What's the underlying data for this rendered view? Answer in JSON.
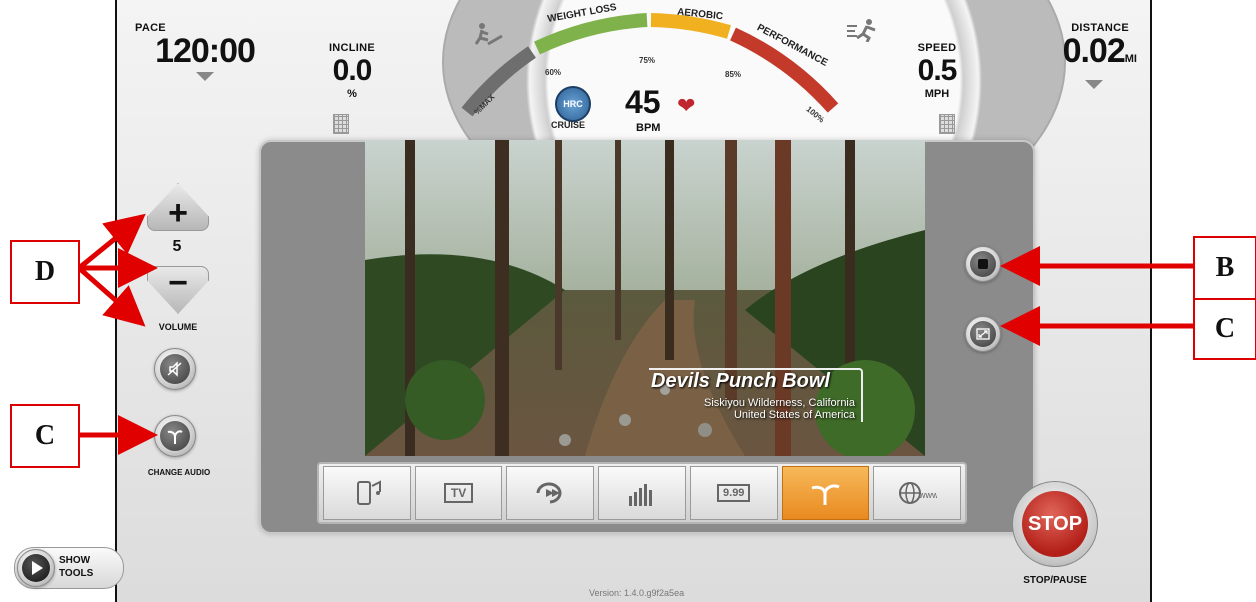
{
  "metrics": {
    "pace": {
      "label": "PACE",
      "value": "120:00"
    },
    "incline": {
      "label": "INCLINE",
      "value": "0.0",
      "unit": "%"
    },
    "speed": {
      "label": "SPEED",
      "value": "0.5",
      "unit": "MPH"
    },
    "distance": {
      "label": "DISTANCE",
      "value": "0.02",
      "unit": "MI"
    }
  },
  "heart_rate": {
    "zones": [
      "WEIGHT LOSS",
      "AEROBIC",
      "PERFORMANCE"
    ],
    "zone_colors": [
      "#7fb24a",
      "#f0b020",
      "#c33a2a"
    ],
    "percent_marks": [
      "%MAX",
      "60%",
      "75%",
      "85%",
      "100%"
    ],
    "mode_icon_text": "HRC",
    "mode_label": "CRUISE",
    "bpm_value": "45",
    "bpm_label": "BPM"
  },
  "volume": {
    "value": "5",
    "label": "VOLUME"
  },
  "audio": {
    "change_label": "CHANGE AUDIO"
  },
  "video": {
    "title": "Devils Punch Bowl",
    "subtitle_line1": "Siskiyou Wilderness, California",
    "subtitle_line2": "United States of America"
  },
  "toolbar": {
    "items": [
      {
        "icon": "phone-music-icon",
        "active": false
      },
      {
        "icon": "tv-icon",
        "text": "TV",
        "active": false
      },
      {
        "icon": "replay-icon",
        "active": false
      },
      {
        "icon": "equalizer-icon",
        "active": false
      },
      {
        "icon": "price-display-icon",
        "text": "9.99",
        "active": false
      },
      {
        "icon": "scenic-route-icon",
        "active": true
      },
      {
        "icon": "web-icon",
        "text": "www",
        "active": false
      }
    ]
  },
  "stop": {
    "button_label": "STOP",
    "caption": "STOP/PAUSE"
  },
  "show_tools": {
    "line1": "SHOW",
    "line2": "TOOLS"
  },
  "version": "Version: 1.4.0.g9f2a5ea",
  "annotations": {
    "d": "D",
    "b": "B",
    "c_right": "C",
    "c_left": "C"
  },
  "colors": {
    "annotation_red": "#e00000",
    "stop_red": "#b21e18",
    "active_orange": "#e98a20"
  }
}
